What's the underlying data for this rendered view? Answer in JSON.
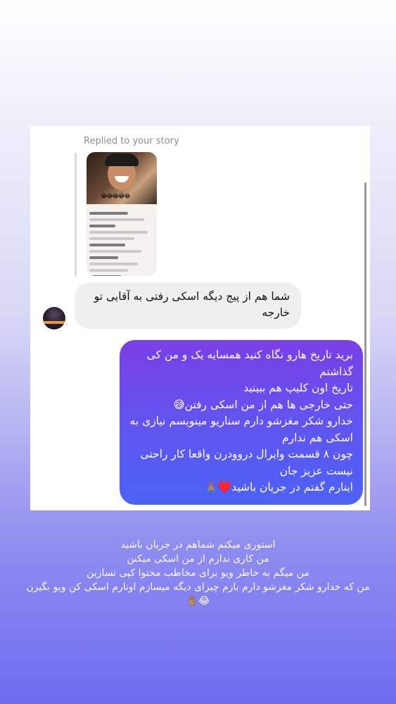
{
  "screenshot": {
    "card": {
      "replied_label": "Replied to your story",
      "story_emojis": "😂😂😂😂😂",
      "incoming_message": "شما هم از پیج دیگه اسکی رفتی به آقایی تو خارجه",
      "outgoing_lines": [
        "برید تاریخ هارو نگاه کنید همسایه یک و من کی گذاشتم",
        "تاریخ اون کلیپ هم ببینید",
        "حتی خارجی ها هم از من اسکی رفتن😅",
        "خدارو شکر مغزشو دارم سناریو مینویسم نیازی به اسکی هم ندارم",
        "چون ۸ قسمت وایرال دروودرن واقعا کار راحتی نیست عزیز جان",
        "اینارم گفتم در جریان باشید♥️🙏🏽"
      ]
    }
  },
  "caption_lines": [
    "استوری میکنم شماهم در جریان باشید",
    "من کاری ندارم از من اسکی میکنن",
    "من میگم به خاطر ویو برای مخاطب محتوا کپی نسازین",
    "من که خدارو شکر مغزشو دارم بازم چیزای دیگه میسازم اونارم اسکی کن ویو بگیرن",
    "😂✋🏽"
  ],
  "colors": {
    "outgoing_bubble_top": "#7b3fe6",
    "outgoing_bubble_bottom": "#4c62f5",
    "incoming_bubble": "#efefef",
    "background_bottom": "#6e6cef"
  }
}
